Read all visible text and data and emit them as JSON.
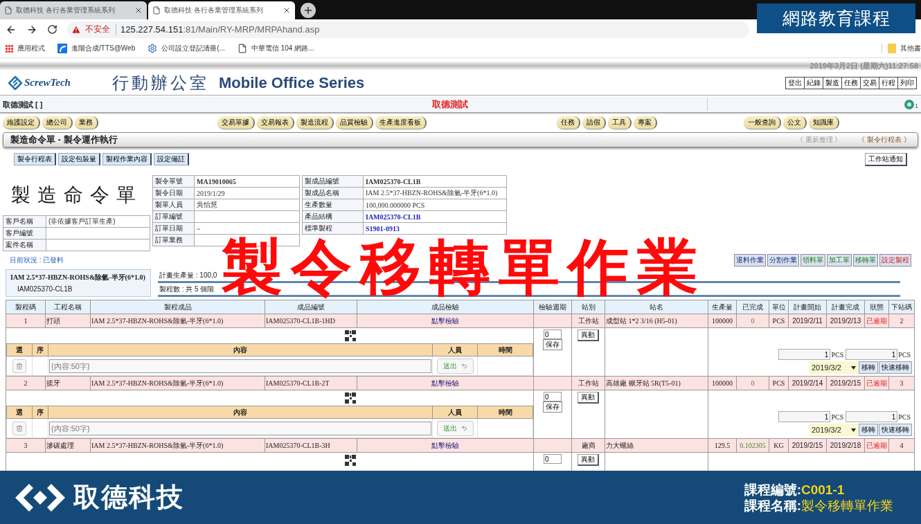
{
  "browser": {
    "tabs": [
      {
        "title": "取德科技 各行各業管理系統系列",
        "selected": false
      },
      {
        "title": "取德科技 各行各業管理系統系列",
        "selected": true
      }
    ],
    "address": {
      "security": "不安全",
      "host": "125.227.54.151",
      "path": ":81/Main/RY-MRP/MRPAhand.asp"
    },
    "bookmarks": [
      {
        "label": "應用程式",
        "kind": "apps"
      },
      {
        "label": "進階合成/TTS@Web",
        "kind": "site"
      },
      {
        "label": "公司設立登記清冊(...",
        "kind": "gear"
      },
      {
        "label": "中華電信 104 網路...",
        "kind": "page"
      }
    ],
    "other_bookmarks": "其他書"
  },
  "course_badge": "網路教育課程",
  "app": {
    "datetime": "2019年3月2日 (星期六)11:27:58",
    "logo": "ScrewTech",
    "title_cn": "行動辦公室",
    "title_en": "Mobile Office Series",
    "top_nav": [
      "登出",
      "紀錄",
      "製造",
      "任務",
      "交易",
      "行程",
      "列印"
    ],
    "user": "取德測試 [ ]",
    "company": "取德測試",
    "notice_count": "1",
    "menu_groups": [
      [
        "維護設定",
        "總公司",
        "業務"
      ],
      [
        "交易單據",
        "交易報表",
        "製造流程",
        "品質檢驗",
        "生產進度看板"
      ],
      [
        "任務",
        "請假",
        "工具",
        "專案"
      ],
      [
        "一般查詢",
        "公文",
        "知識庫"
      ]
    ],
    "section_title": "製造命令單 - 製令運作執行",
    "section_links": [
      {
        "label": "《 重新整理 》",
        "disabled": true
      },
      {
        "label": "《 製令行程表 》",
        "disabled": false
      }
    ],
    "tools": [
      "製令行程表",
      "設定包裝量",
      "製程作業內容",
      "設定備註"
    ],
    "station_notice": "工作站通知"
  },
  "order": {
    "heading": "製造命令單",
    "customer": [
      {
        "label": "客戶名稱",
        "value": "(非依據客戶訂單生產)"
      },
      {
        "label": "客戶編號"
      },
      {
        "label": "案件名稱"
      }
    ],
    "order_info": [
      {
        "label": "製令單號",
        "value": "MA19010065",
        "kind": "bold"
      },
      {
        "label": "製令日期",
        "value": "2019/1/29",
        "kind": "plain"
      },
      {
        "label": "製單人員",
        "value": "吳怡慧",
        "kind": "plain"
      },
      {
        "label": "訂單編號",
        "kind": "plain"
      },
      {
        "label": "訂單日期",
        "value": "~",
        "kind": "plain"
      },
      {
        "label": "訂單業務",
        "kind": "plain"
      }
    ],
    "product_info": [
      {
        "label": "製成品編號",
        "value": "IAM025370-CL1B",
        "kind": "bold"
      },
      {
        "label": "製成品名稱",
        "value": "IAM 2.5*37-HBZN-ROHS&除氫-半牙(6*1.0)",
        "kind": "plain"
      },
      {
        "label": "生產數量",
        "value": "100,000.000000 PCS",
        "kind": "plain"
      },
      {
        "label": "產品結構",
        "value": "IAM025370-CL1B",
        "kind": "link"
      },
      {
        "label": "標準製程",
        "value": "S1901-0913",
        "kind": "link"
      }
    ]
  },
  "status": "目前狀況 : 已發料",
  "actions": [
    {
      "label": "退料作業",
      "kind": "task"
    },
    {
      "label": "分割作業",
      "kind": "task"
    },
    {
      "label": "領料單",
      "kind": "form"
    },
    {
      "label": "加工單",
      "kind": "form"
    },
    {
      "label": "移轉單",
      "kind": "form"
    },
    {
      "label": "設定製程",
      "kind": "setup"
    }
  ],
  "summary": {
    "product_name": "IAM 2.5*37-HBZN-ROHS&除氫-半牙(6*1.0)",
    "product_no": "IAM025370-CL1B",
    "stats": [
      "計畫生產量 : 100,0",
      "製程數 : 共 5 個階"
    ]
  },
  "table": {
    "columns": [
      "製程碼",
      "工程名稱",
      "製程成品",
      "成品編號",
      "成品檢驗",
      "檢驗週期",
      "站別",
      "站名",
      "生產量",
      "已完成",
      "單位",
      "計畫開始",
      "計畫完成",
      "狀態",
      "下站碼"
    ],
    "rows": [
      {
        "code": "1",
        "name": "打頭",
        "product": "IAM 2.5*37-HBZN-ROHS&除氫-半牙(6*1.0)",
        "product_no": "IAM025370-CL1B-1HD",
        "inspect": "點擊檢驗",
        "station_type": "工作站",
        "station": "成型站 1*2 3/16 (H5-01)",
        "qty": "100000",
        "done": "0",
        "unit": "PCS",
        "start": "2019/2/11",
        "end": "2019/2/13",
        "status": "已逾期",
        "next": "2",
        "detail": {
          "cycle": "0",
          "save": "保存",
          "change": "異動",
          "note_headers": [
            "選",
            "序",
            "內容",
            "人員",
            "時間"
          ],
          "note_placeholder": "{內容:50字}",
          "send": "送出",
          "qty_a": "1",
          "unit_a": "PCS",
          "qty_b": "1",
          "unit_b": "PCS",
          "date": "2019/3/2",
          "move": "移轉",
          "quick_move": "快速移轉"
        }
      },
      {
        "code": "2",
        "name": "搓牙",
        "product": "IAM 2.5*37-HBZN-ROHS&除氫-半牙(6*1.0)",
        "product_no": "IAM025370-CL1B-2T",
        "inspect": "點擊檢驗",
        "station_type": "工作站",
        "station": "高雄廠 輾牙站 5R(T5-01)",
        "qty": "100000",
        "done": "0",
        "unit": "PCS",
        "start": "2019/2/14",
        "end": "2019/2/15",
        "status": "已逾期",
        "next": "3",
        "detail": {
          "cycle": "0",
          "save": "保存",
          "change": "異動",
          "note_headers": [
            "選",
            "序",
            "內容",
            "人員",
            "時間"
          ],
          "note_placeholder": "{內容:50字}",
          "send": "送出",
          "qty_a": "1",
          "unit_a": "PCS",
          "qty_b": "1",
          "unit_b": "PCS",
          "date": "2019/3/2",
          "move": "移轉",
          "quick_move": "快速移轉"
        }
      },
      {
        "code": "3",
        "name": "滲碳處理",
        "product": "IAM 2.5*37-HBZN-ROHS&除氫-半牙(6*1.0)",
        "product_no": "IAM025370-CL1B-3H",
        "inspect": "點擊檢驗",
        "station_type": "廠商",
        "station": "力大螺絲",
        "qty": "129.5",
        "done": "0.102305",
        "unit": "KG",
        "start": "2019/2/15",
        "end": "2019/2/18",
        "status": "已逾期",
        "next": "4",
        "detail": {
          "cycle": "0",
          "change": "異動"
        }
      }
    ]
  },
  "overlay_title": "製令移轉單作業",
  "banner": {
    "company": "取德科技",
    "code_label": "課程編號:",
    "code": "C001-1",
    "name_label": "課程名稱:",
    "name": "製令移轉單作業"
  }
}
